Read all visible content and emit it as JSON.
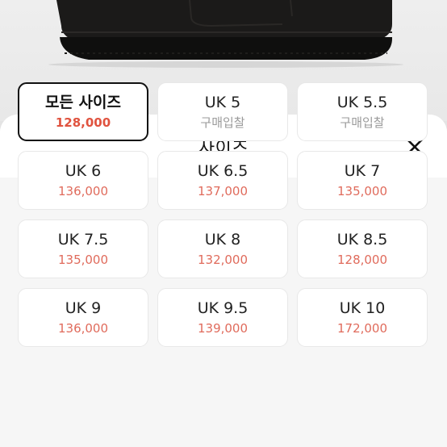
{
  "sheet": {
    "title": "사이즈",
    "close_icon": "close-icon"
  },
  "colors": {
    "price": "#e06b5c",
    "price_selected": "#e0533f",
    "bid": "#9a9a9a",
    "selected_border": "#111111"
  },
  "sizes": [
    {
      "label": "모든 사이즈",
      "price": "128,000",
      "type": "price",
      "selected": true
    },
    {
      "label": "UK 5",
      "price": "구매입찰",
      "type": "bid",
      "selected": false
    },
    {
      "label": "UK 5.5",
      "price": "구매입찰",
      "type": "bid",
      "selected": false
    },
    {
      "label": "UK 6",
      "price": "136,000",
      "type": "price",
      "selected": false
    },
    {
      "label": "UK 6.5",
      "price": "137,000",
      "type": "price",
      "selected": false
    },
    {
      "label": "UK 7",
      "price": "135,000",
      "type": "price",
      "selected": false
    },
    {
      "label": "UK 7.5",
      "price": "135,000",
      "type": "price",
      "selected": false
    },
    {
      "label": "UK 8",
      "price": "132,000",
      "type": "price",
      "selected": false
    },
    {
      "label": "UK 8.5",
      "price": "128,000",
      "type": "price",
      "selected": false
    },
    {
      "label": "UK 9",
      "price": "136,000",
      "type": "price",
      "selected": false
    },
    {
      "label": "UK 9.5",
      "price": "139,000",
      "type": "price",
      "selected": false
    },
    {
      "label": "UK 10",
      "price": "172,000",
      "type": "price",
      "selected": false
    }
  ]
}
